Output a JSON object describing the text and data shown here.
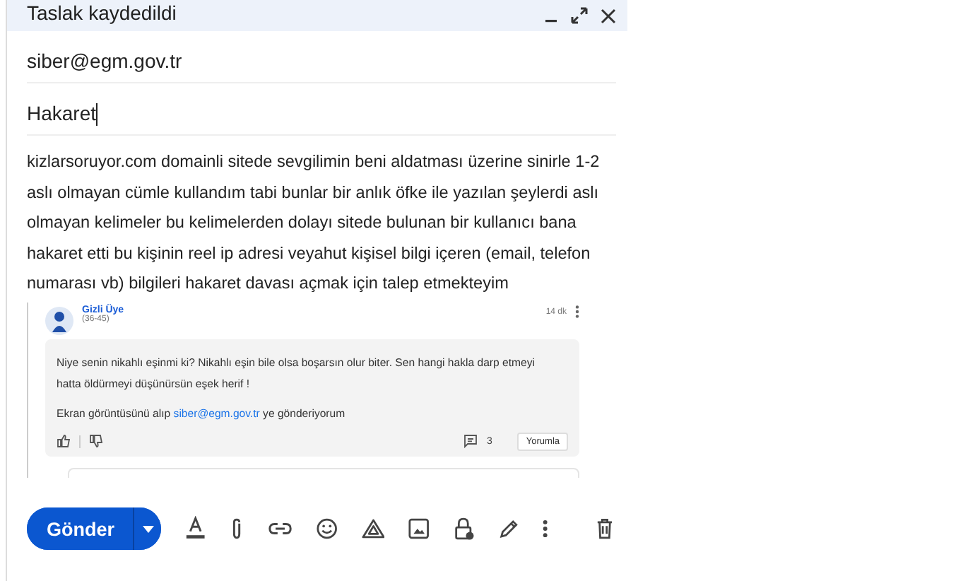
{
  "window": {
    "title": "Taslak kaydedildi"
  },
  "to": "siber@egm.gov.tr",
  "subject": "Hakaret",
  "body": "kizlarsoruyor.com domainli sitede sevgilimin beni aldatması üzerine sinirle 1-2 aslı olmayan cümle kullandım tabi bunlar bir anlık öfke ile yazılan şeylerdi aslı olmayan kelimeler bu kelimelerden dolayı sitede bulunan bir kullanıcı bana hakaret etti bu kişinin reel ip adresi veyahut kişisel bilgi içeren (email, telefon numarası vb) bilgileri hakaret davası açmak için talep etmekteyim",
  "comment": {
    "author": "Gizli Üye",
    "age_range": "(36-45)",
    "time": "14 dk",
    "text": "Niye senin nikahlı eşinmi ki? Nikahlı eşin bile olsa boşarsın olur biter. Sen hangi hakla darp etmeyi hatta öldürmeyi düşünürsün eşek herif !",
    "text_before_link": "Ekran görüntüsünü alıp",
    "link": "siber@egm.gov.tr",
    "text_after_link": "ye gönderiyorum",
    "reply_count": "3",
    "reply_button": "Yorumla"
  },
  "send_button": "Gönder"
}
